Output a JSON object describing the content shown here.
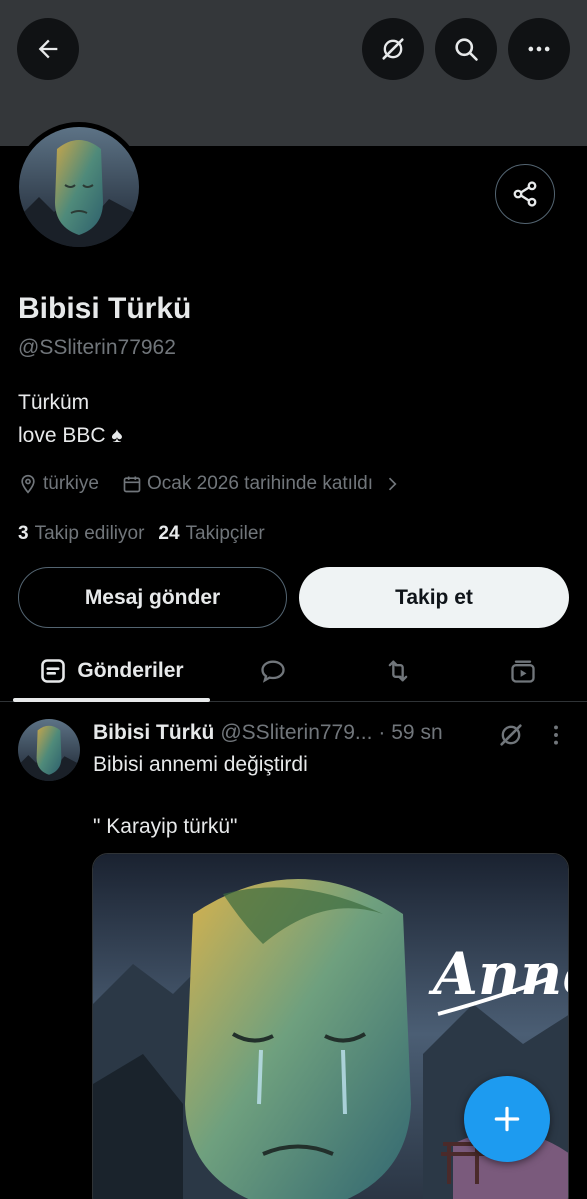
{
  "colors": {
    "background": "#000000",
    "banner": "#34373a",
    "text_primary": "#e7e9ea",
    "text_secondary": "#71767b",
    "accent": "#1d9bf0",
    "follow_button": "#eff3f4"
  },
  "header": {
    "icons": [
      "back-arrow-icon",
      "grok-icon",
      "search-icon",
      "more-icon"
    ]
  },
  "profile": {
    "name": "Bibisi Türkü",
    "handle": "@SSliterin77962",
    "bio_line1": "Türküm",
    "bio_line2": "love BBC ♠",
    "location": "türkiye",
    "joined": "Ocak 2026 tarihinde katıldı",
    "following_count": "3",
    "following_label": "Takip ediliyor",
    "followers_count": "24",
    "followers_label": "Takipçiler",
    "message_button": "Mesaj gönder",
    "follow_button": "Takip et"
  },
  "tabs": {
    "active_label": "Gönderiler",
    "icons": [
      "posts-icon",
      "replies-icon",
      "reposts-icon",
      "media-icon"
    ]
  },
  "post": {
    "author_name": "Bibisi Türkü",
    "author_handle": "@SSliterin779...",
    "time": "· 59 sn",
    "text_line1": "Bibisi annemi değiştirdi",
    "text_line2": "\" Karayip türkü\"",
    "media_text": "Anne"
  }
}
